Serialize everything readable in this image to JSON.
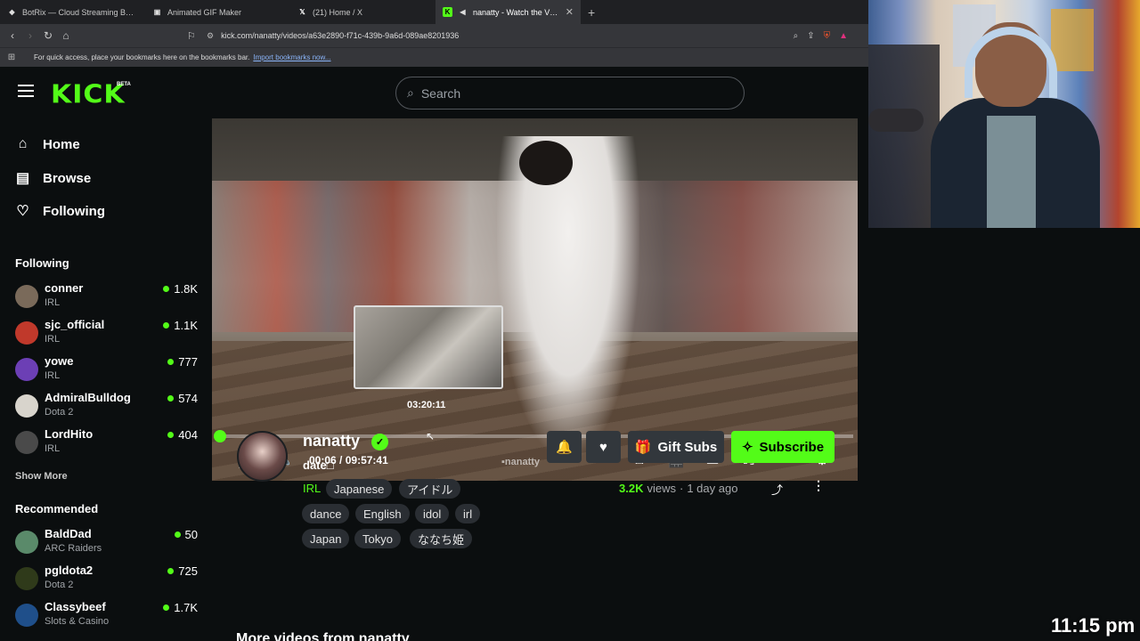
{
  "browser": {
    "tabs": [
      {
        "title": "BotRix — Cloud Streaming Bot for Tw",
        "favicon": "botrix-icon",
        "active": false
      },
      {
        "title": "Animated GIF Maker",
        "favicon": "gif-icon",
        "active": false
      },
      {
        "title": "(21) Home / X",
        "favicon": "x-icon",
        "active": false
      },
      {
        "title": "nanatty - Watch the VOD on",
        "favicon": "kick-icon",
        "active": true
      }
    ],
    "url": "kick.com/nanatty/videos/a63e2890-f71c-439b-9a6d-089ae8201936",
    "bookmarks_msg": "For quick access, place your bookmarks here on the bookmarks bar.",
    "bookmarks_link": "Import bookmarks now..."
  },
  "header": {
    "logo": "KICK",
    "beta": "BETA",
    "search_placeholder": "Search"
  },
  "nav": {
    "home": "Home",
    "browse": "Browse",
    "following": "Following"
  },
  "following_section": {
    "title": "Following",
    "channels": [
      {
        "name": "conner",
        "category": "IRL",
        "viewers": "1.8K",
        "color": "#7a6a5a"
      },
      {
        "name": "sjc_official",
        "category": "IRL",
        "viewers": "1.1K",
        "color": "#c0392b"
      },
      {
        "name": "yowe",
        "category": "IRL",
        "viewers": "777",
        "color": "#6c3fb5"
      },
      {
        "name": "AdmiralBulldog",
        "category": "Dota 2",
        "viewers": "574",
        "color": "#d8d4cc"
      },
      {
        "name": "LordHito",
        "category": "IRL",
        "viewers": "404",
        "color": "#4a4a4a"
      }
    ],
    "show_more": "Show More"
  },
  "recommended_section": {
    "title": "Recommended",
    "channels": [
      {
        "name": "BaldDad",
        "category": "ARC Raiders",
        "viewers": "50",
        "color": "#5a8a6a"
      },
      {
        "name": "pgldota2",
        "category": "Dota 2",
        "viewers": "725",
        "color": "#2f3a1a"
      },
      {
        "name": "Classybeef",
        "category": "Slots & Casino",
        "viewers": "1.7K",
        "color": "#1f4f8a"
      }
    ]
  },
  "player": {
    "hover_time": "03:20:11",
    "current_time": "00:06",
    "duration": "09:57:41",
    "time_sep": "/",
    "progress_fraction": 0.001,
    "watermark": "nanatty"
  },
  "channel": {
    "name": "nanatty",
    "title": "date□",
    "category": "IRL",
    "tags": [
      "Japanese",
      "アイドル",
      "dance",
      "English",
      "idol",
      "irl",
      "Japan",
      "Tokyo",
      "ななち姫"
    ],
    "views": "3.2K",
    "views_label": "views",
    "dot": "·",
    "age": "1 day ago",
    "gift_label": "Gift Subs",
    "subscribe_label": "Subscribe"
  },
  "more_videos": "More videos from nanatty",
  "overlay_clock": "11:15 pm",
  "colors": {
    "accent": "#53fc18",
    "bg": "#0b0e0f",
    "panel": "#32373c"
  }
}
